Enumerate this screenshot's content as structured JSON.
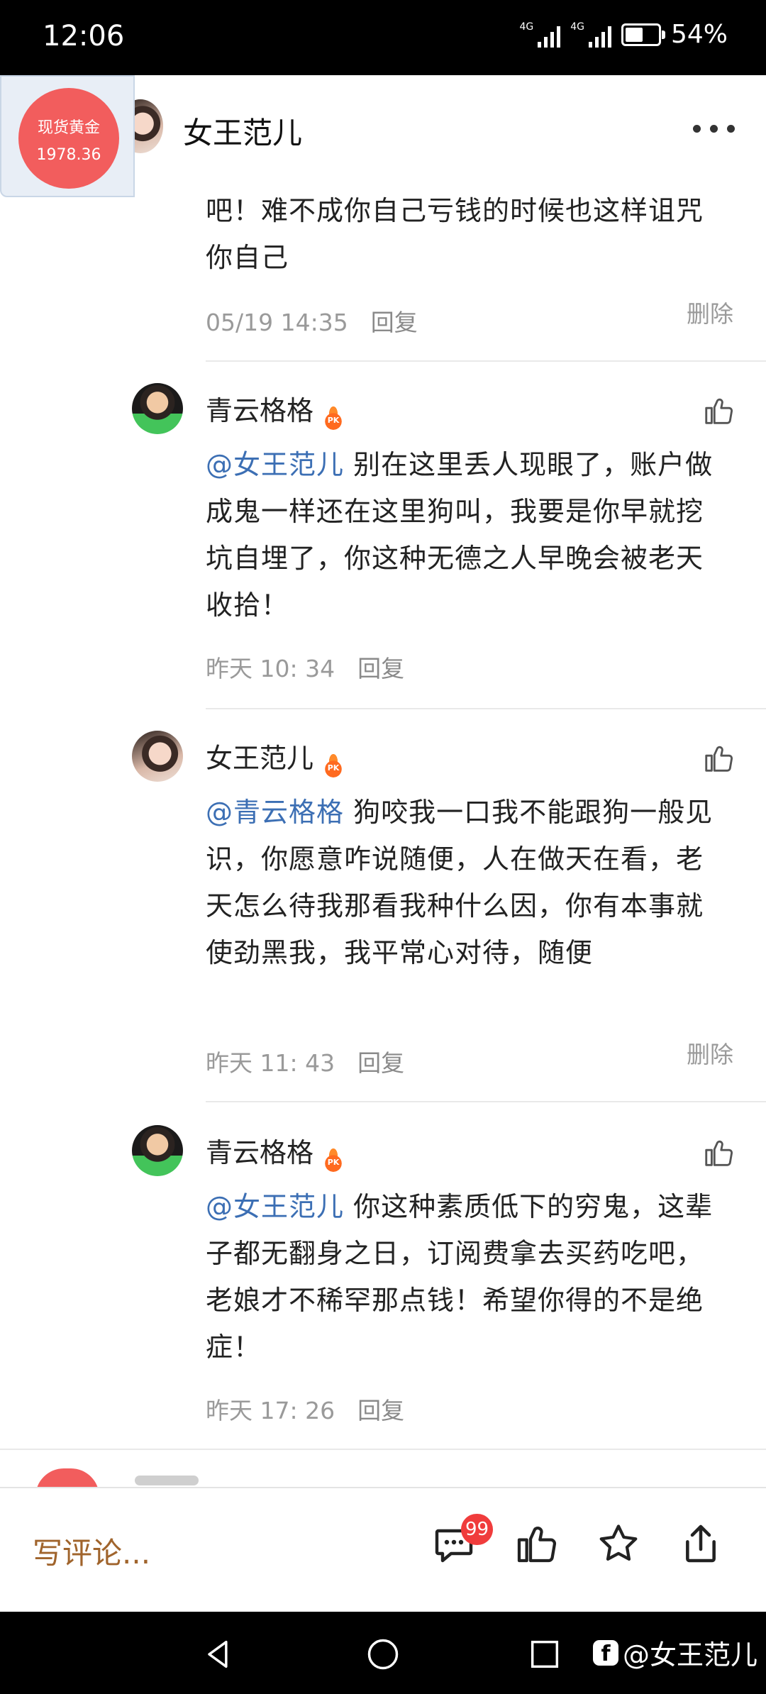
{
  "status_bar": {
    "time": "12:06",
    "network1": "4G",
    "network2": "4G",
    "battery": "54%",
    "battery_level": 0.54
  },
  "header": {
    "title": "女王范儿",
    "gold_label": "现货黄金",
    "gold_value": "1978.36"
  },
  "top_comment": {
    "text": "吧！难不成你自己亏钱的时候也这样诅咒你自己",
    "time": "05/19 14:35",
    "reply": "回复",
    "delete": "删除"
  },
  "replies": [
    {
      "name": "青云格格",
      "mention": "@女王范儿",
      "text": " 别在这里丢人现眼了，账户做成鬼一样还在这里狗叫，我要是你早就挖坑自埋了，你这种无德之人早晚会被老天收拾！",
      "time": "昨天 10: 34",
      "reply": "回复"
    },
    {
      "name": "女王范儿",
      "mention": "@青云格格",
      "text": " 狗咬我一口我不能跟狗一般见识，你愿意咋说随便，人在做天在看，老天怎么待我那看我种什么因，你有本事就使劲黑我，我平常心对待，随便",
      "time": "昨天 11: 43",
      "reply": "回复",
      "delete": "删除"
    },
    {
      "name": "青云格格",
      "mention": "@女王范儿",
      "text": " 你这种素质低下的穷鬼，这辈子都无翻身之日，订阅费拿去买药吃吧，老娘才不稀罕那点钱！希望你得的不是绝症！",
      "time": "昨天 17: 26",
      "reply": "回复"
    }
  ],
  "bottom_bar": {
    "placeholder": "写评论...",
    "badge": "99"
  },
  "watermark": {
    "icon": "f",
    "text": "@女王范儿"
  }
}
